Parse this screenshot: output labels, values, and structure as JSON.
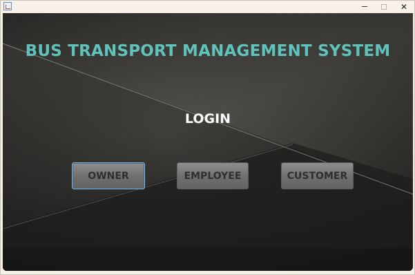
{
  "window": {
    "app_icon": "java-cup-icon",
    "controls": {
      "minimize_icon": "minimize-icon",
      "maximize_icon": "maximize-icon",
      "close_label": "✕"
    }
  },
  "main": {
    "title": "BUS TRANSPORT MANAGEMENT SYSTEM",
    "login_heading": "LOGIN",
    "buttons": {
      "owner": "OWNER",
      "employee": "EMPLOYEE",
      "customer": "CUSTOMER"
    }
  },
  "colors": {
    "title": "#5fc2bb",
    "heading": "#ffffff",
    "button_text": "#2f2f2f"
  }
}
